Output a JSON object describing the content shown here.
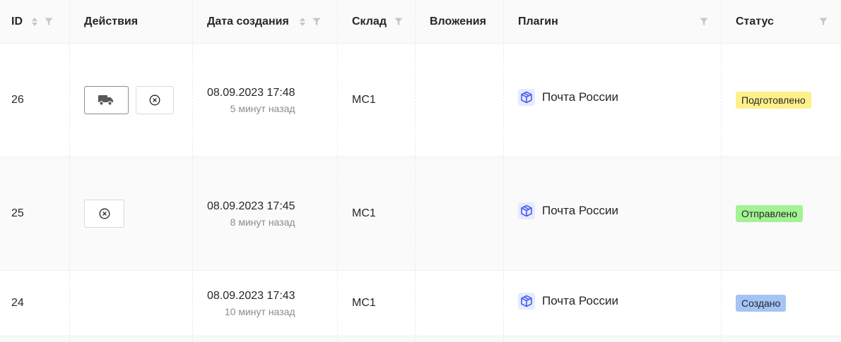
{
  "columns": {
    "id": "ID",
    "actions": "Действия",
    "created": "Дата создания",
    "warehouse": "Склад",
    "attachments": "Вложения",
    "plugin": "Плагин",
    "status": "Статус"
  },
  "rows": [
    {
      "id": "26",
      "date": "08.09.2023 17:48",
      "relative": "5 минут назад",
      "warehouse": "МС1",
      "plugin": "Почта России",
      "status": "Подготовлено",
      "status_color": "#fef08a",
      "actions": [
        "truck-icon",
        "cancel-icon"
      ]
    },
    {
      "id": "25",
      "date": "08.09.2023 17:45",
      "relative": "8 минут назад",
      "warehouse": "МС1",
      "plugin": "Почта России",
      "status": "Отправлено",
      "status_color": "#a3f294",
      "actions": [
        "cancel-icon"
      ]
    },
    {
      "id": "24",
      "date": "08.09.2023 17:43",
      "relative": "10 минут назад",
      "warehouse": "МС1",
      "plugin": "Почта России",
      "status": "Создано",
      "status_color": "#a3c4f5",
      "actions": []
    }
  ],
  "colors": {
    "plugin_logo": "#4a5cf0",
    "header_bg": "#fafafa",
    "row_alt_bg": "#fafafa"
  }
}
